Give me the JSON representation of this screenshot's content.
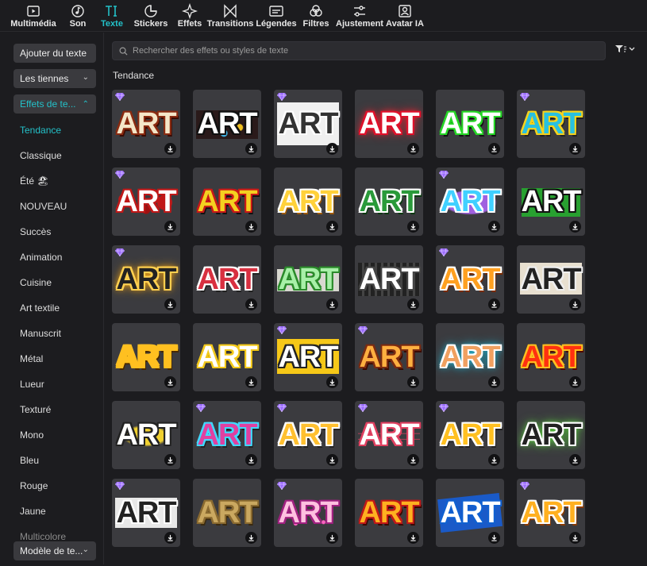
{
  "toolbar": {
    "items": [
      {
        "label": "Multimédia",
        "icon": "media-icon"
      },
      {
        "label": "Son",
        "icon": "music-note-icon"
      },
      {
        "label": "Texte",
        "icon": "text-icon"
      },
      {
        "label": "Stickers",
        "icon": "sticker-icon"
      },
      {
        "label": "Effets",
        "icon": "sparkle-icon"
      },
      {
        "label": "Transitions",
        "icon": "transition-icon"
      },
      {
        "label": "Légendes",
        "icon": "captions-icon"
      },
      {
        "label": "Filtres",
        "icon": "filters-icon"
      },
      {
        "label": "Ajustement",
        "icon": "sliders-icon"
      },
      {
        "label": "Avatar IA",
        "icon": "avatar-icon"
      }
    ],
    "active_index": 2
  },
  "sidebar": {
    "buttons": [
      {
        "label": "Ajouter du texte"
      },
      {
        "label": "Les tiennes",
        "chevron": "down"
      },
      {
        "label": "Effets de te...",
        "chevron": "up",
        "active": true
      }
    ],
    "categories": [
      {
        "label": "Tendance",
        "active": true
      },
      {
        "label": "Classique"
      },
      {
        "label": "Été 🏖"
      },
      {
        "label": "NOUVEAU"
      },
      {
        "label": "Succès"
      },
      {
        "label": "Animation"
      },
      {
        "label": "Cuisine"
      },
      {
        "label": "Art textile"
      },
      {
        "label": "Manuscrit"
      },
      {
        "label": "Métal"
      },
      {
        "label": "Lueur"
      },
      {
        "label": "Texturé"
      },
      {
        "label": "Mono"
      },
      {
        "label": "Bleu"
      },
      {
        "label": "Rouge"
      },
      {
        "label": "Jaune"
      },
      {
        "label": "Multicolore"
      }
    ],
    "bottom_button": {
      "label": "Modèle de te...",
      "chevron": "down"
    }
  },
  "search": {
    "placeholder": "Rechercher des effets ou styles de texte",
    "value": ""
  },
  "section_title": "Tendance",
  "card_text": "ART",
  "colors": {
    "accent": "#23c1c9",
    "premium_gem": "#9b6bff"
  },
  "cards": [
    {
      "fill": "#f5e6c8",
      "stroke": "#8a2a10",
      "shadow": "#3a0a00",
      "premium": true
    },
    {
      "fill": "#ffffff",
      "stroke": "#111111",
      "bg": "flowers",
      "premium": false
    },
    {
      "fill": "#333333",
      "stroke": "#ffffff",
      "bg": "paper",
      "premium": true
    },
    {
      "fill": "#ffffff",
      "stroke": "#e0102a",
      "glow": "#ff2030",
      "premium": false
    },
    {
      "fill": "#ffffff",
      "stroke": "#26d626",
      "shadow": "#111111",
      "premium": false
    },
    {
      "fill": "#28c0e0",
      "stroke": "#f6d21c",
      "shadow": "#222222",
      "premium": true
    },
    {
      "fill": "#ffffff",
      "stroke": "#c01818",
      "bg": "splatter",
      "premium": true
    },
    {
      "fill": "#f4d020",
      "stroke": "#c81818",
      "shadow": "#111111",
      "premium": false
    },
    {
      "fill": "#ffd13a",
      "stroke": "#ffffff",
      "shadow": "#a05a00",
      "premium": false
    },
    {
      "fill": "#2a9a3a",
      "stroke": "#ffffff",
      "shadow": "#0a3a10",
      "premium": false
    },
    {
      "fill": "#40d0ff",
      "stroke": "#ffffff",
      "bg": "purple-splat",
      "premium": true
    },
    {
      "fill": "#ffffff",
      "stroke": "#111111",
      "bg": "green-brush",
      "premium": false
    },
    {
      "fill": "#222222",
      "stroke": "#ffd050",
      "glow": "#ffaa10",
      "premium": true
    },
    {
      "fill": "#d83040",
      "stroke": "#ffffff",
      "shadow": "#222222",
      "premium": false
    },
    {
      "fill": "#a8f0a8",
      "stroke": "#2a8a2a",
      "bg": "paper-strip",
      "premium": false
    },
    {
      "fill": "#ffffff",
      "stroke": "#444444",
      "bg": "film",
      "premium": false
    },
    {
      "fill": "#ffa020",
      "stroke": "#ffffff",
      "shadow": "#7a2a00",
      "premium": true
    },
    {
      "fill": "#222222",
      "stroke": "#eeeeee",
      "bg": "torn-paper",
      "premium": false
    },
    {
      "fill": "#ffc020",
      "stroke": "#ffc020",
      "shadow": "#4a2a00",
      "premium": false
    },
    {
      "fill": "#ffffff",
      "stroke": "#f2c81a",
      "shadow": "#333333",
      "premium": false
    },
    {
      "fill": "#ffffff",
      "stroke": "#222222",
      "bg": "yellow-brush",
      "premium": true
    },
    {
      "fill": "#ffb040",
      "stroke": "#7a2a10",
      "shadow": "#3a0a00",
      "premium": true
    },
    {
      "fill": "#f0a060",
      "stroke": "#ffffff",
      "glow": "#20c0e0",
      "premium": false
    },
    {
      "fill": "#ff3010",
      "stroke": "#ffc020",
      "shadow": "#500800",
      "premium": false
    },
    {
      "fill": "#ffffff",
      "stroke": "#222222",
      "bg": "yellow-strip",
      "premium": false
    },
    {
      "fill": "#e040a0",
      "stroke": "#40d8ff",
      "shadow": "#222222",
      "premium": true
    },
    {
      "fill": "#ffc030",
      "stroke": "#ffffff",
      "shadow": "#222222",
      "premium": true
    },
    {
      "fill": "#ffffff",
      "stroke": "#e04060",
      "bg": "glitch",
      "premium": true
    },
    {
      "fill": "#ffc020",
      "stroke": "#ffffff",
      "shadow": "#222222",
      "premium": true
    },
    {
      "fill": "#222222",
      "stroke": "#ffffff",
      "glow": "#60e040",
      "premium": false
    },
    {
      "fill": "#222222",
      "stroke": "#ffffff",
      "bg": "grunge",
      "premium": true
    },
    {
      "fill": "#caa860",
      "stroke": "#8a6a30",
      "shadow": "#3a2a10",
      "premium": false
    },
    {
      "fill": "#ffc0e0",
      "stroke": "#a02080",
      "bg": "sparkles",
      "premium": true
    },
    {
      "fill": "#ffb020",
      "stroke": "#c01818",
      "shadow": "#3a0800",
      "premium": false
    },
    {
      "fill": "#ffffff",
      "stroke": "#1060d0",
      "bg": "blue-brush",
      "premium": false
    },
    {
      "fill": "#ffb020",
      "stroke": "#ffffff",
      "shadow": "#8a3a00",
      "premium": true
    }
  ]
}
